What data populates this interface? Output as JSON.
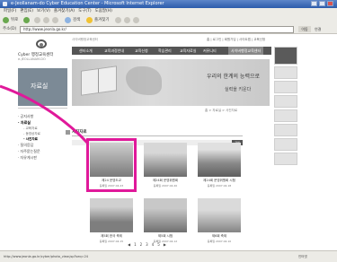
{
  "window": {
    "title": "e-Jeollanam-do Cyber Education Center - Microsoft Internet Explorer"
  },
  "menubar": [
    "파일(F)",
    "편집(E)",
    "보기(V)",
    "즐겨찾기(A)",
    "도구(T)",
    "도움말(H)"
  ],
  "toolbar": {
    "back_label": "뒤로",
    "search_label": "검색",
    "favorites_label": "즐겨찾기"
  },
  "addressbar": {
    "label": "주소(D)",
    "url": "http://www.jeonla.go.kr/",
    "go_label": "이동",
    "links_label": "연결"
  },
  "site": {
    "logo_text": "Cyber 행정교육센터",
    "logo_sub": "e-JEOLLANAM-DO",
    "top_note": "사이버행정교육센터",
    "top_util": "홈 | 로그인 | 회원가입 | 사이트맵 | 교육신청",
    "nav": [
      "센터소개",
      "교육과정안내",
      "교육신청",
      "학습관리",
      "교육자료실",
      "커뮤니티",
      "사이버행정교육센터"
    ],
    "left_banner": "자료실",
    "banner_slogan": "우리의 한계의 능력으로",
    "banner_slogan2": "실력을 키운다",
    "location": "홈 > 자료실 > 사진자료"
  },
  "leftmenu": [
    {
      "label": "· 공지사항",
      "sub": false,
      "selected": false
    },
    {
      "label": "· 자료실",
      "sub": false,
      "selected": true
    },
    {
      "label": "- 교육자료",
      "sub": true,
      "selected": false
    },
    {
      "label": "- 동영상자료",
      "sub": true,
      "selected": false
    },
    {
      "label": "- 사진자료",
      "sub": true,
      "selected": true
    },
    {
      "label": "· 질의응답",
      "sub": false,
      "selected": false
    },
    {
      "label": "· 자주묻는질문",
      "sub": false,
      "selected": false
    },
    {
      "label": "· 자유게시판",
      "sub": false,
      "selected": false
    }
  ],
  "content": {
    "title": "사진자료",
    "search_btn": "검색"
  },
  "gallery": [
    {
      "caption": "제24 운영도교",
      "date": "등록일 2007.04.23"
    },
    {
      "caption": "제24회 운영위원회",
      "date": "등록일 2007.04.20"
    },
    {
      "caption": "제24회 운영위원회 시험",
      "date": "등록일 2007.04.18"
    },
    {
      "caption": "제5회 한국 축제",
      "date": "등록일 2007.04.15"
    },
    {
      "caption": "제5회 시험",
      "date": "등록일 2007.04.12"
    },
    {
      "caption": "제6회 축제",
      "date": "등록일 2007.04.10"
    }
  ],
  "pager": [
    "◀",
    "1",
    "2",
    "3",
    "4",
    "5",
    "▶"
  ],
  "statusbar": {
    "text": "http://www.jeonla.go.kr/cyber/photo_view.jsp?seq=24",
    "zone": "인터넷"
  },
  "colors": {
    "highlight": "#e0199a",
    "nav_bg": "#555555"
  }
}
